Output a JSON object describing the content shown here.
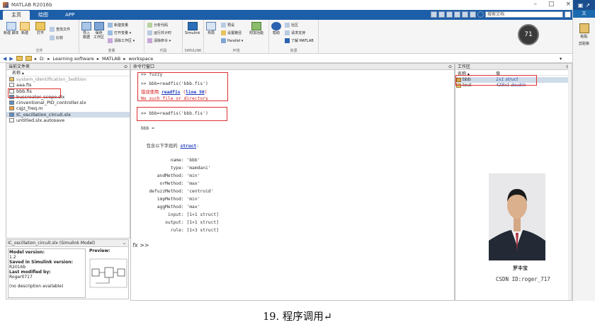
{
  "window": {
    "title": "MATLAB R2016b"
  },
  "tabs": [
    "主页",
    "绘图",
    "APP"
  ],
  "search_placeholder": "搜索文档",
  "right_strip": {
    "top_label": "文档",
    "tab_label": "文档",
    "paste_label": "粘贴",
    "clipboard_label": "剪贴板"
  },
  "ribbon": {
    "groups": [
      "文件",
      "变量",
      "代码",
      "SIMULINK",
      "环境",
      "资源"
    ],
    "file": {
      "new_script": "新建\n脚本",
      "new": "新建",
      "open": "打开",
      "find_files": "查找文件",
      "compare": "比较"
    },
    "variable": {
      "import": "导入\n数据",
      "save_workspace": "保存\n工作区",
      "new_variable": "新建变量",
      "open_variable": "打开变量 ▾",
      "clear_workspace": "清除工作区 ▾"
    },
    "code": {
      "analyze": "分析代码",
      "run_time": "运行并计时",
      "clear_cmd": "清除命令 ▾"
    },
    "simulink": {
      "simulink": "Simulink"
    },
    "env": {
      "layout": "布局",
      "preferences": "预设",
      "set_path": "设置路径",
      "addons": "附加功能",
      "parallel": "Parallel ▾"
    },
    "resources": {
      "help": "帮助",
      "community": "社区",
      "request_support": "请求支持",
      "learn": "了解 MATLAB"
    }
  },
  "badge": "71",
  "pathbar": {
    "segments": [
      "D:",
      "Learning software",
      "MATLAB",
      "workspace"
    ]
  },
  "current_folder": {
    "title": "当前文件夹",
    "column": "名称 ▴",
    "items": [
      {
        "name": "system_identification_3edition",
        "type": "folder",
        "gray": true
      },
      {
        "name": "aaa.fis",
        "type": "file",
        "gray": false
      },
      {
        "name": "bbb.fis",
        "type": "file",
        "gray": false
      },
      {
        "name": "buscreator_scope.slx",
        "type": "slx",
        "gray": false
      },
      {
        "name": "cinventional_PID_controller.slx",
        "type": "slx",
        "gray": false
      },
      {
        "name": "cqjz_freq.m",
        "type": "m",
        "gray": false
      },
      {
        "name": "IC_oscillation_circuit.slx",
        "type": "slx",
        "gray": false
      },
      {
        "name": "untitled.slx.autosave",
        "type": "file",
        "gray": false
      }
    ]
  },
  "details": {
    "header": "IC_oscillation_circuit.slx  (Simulink Model)",
    "model_version_label": "Model version:",
    "model_version": "1.2",
    "saved_label": "Saved in Simulink version:",
    "saved": "R2016b",
    "modified_label": "Last modified by:",
    "modified": "Roger0717",
    "description": "(no description available)",
    "preview_label": "Preview:"
  },
  "command_window": {
    "title": "命令行窗口",
    "lines": [
      {
        "t": ">> fuzzy"
      },
      {
        "t": ">> bbb=readfis('bbb.fis')"
      },
      {
        "err1": "错误使用 ",
        "err_link": "readfis",
        "err2": " (",
        "err_line": "line 50",
        "err3": ")"
      },
      {
        "t": "No such file or directory"
      },
      {
        "t": ">> bbb=readfis('bbb.fis')"
      },
      {
        "t": "bbb ="
      },
      {
        "pre": "  包含以下字段的 ",
        "link": "struct",
        "post": ":"
      },
      {
        "t": "           name: 'bbb'"
      },
      {
        "t": "           type: 'mamdani'"
      },
      {
        "t": "      andMethod: 'min'"
      },
      {
        "t": "       orMethod: 'max'"
      },
      {
        "t": "   defuzzMethod: 'centroid'"
      },
      {
        "t": "      impMethod: 'min'"
      },
      {
        "t": "      aggMethod: 'max'"
      },
      {
        "t": "          input: [1×1 struct]"
      },
      {
        "t": "         output: [1×1 struct]"
      },
      {
        "t": "           rule: [1×3 struct]"
      }
    ],
    "prompt": "fx >>"
  },
  "workspace": {
    "title": "工作区",
    "col_name": "名称 ▴",
    "col_value": "值",
    "rows": [
      {
        "name": "bbb",
        "value": "1x1 struct"
      },
      {
        "name": "tout",
        "value": "428x1 double"
      }
    ]
  },
  "stamp": "罗丰宝",
  "watermark": "CSDN ID:roger_717",
  "caption": "19. 程序调用↵"
}
